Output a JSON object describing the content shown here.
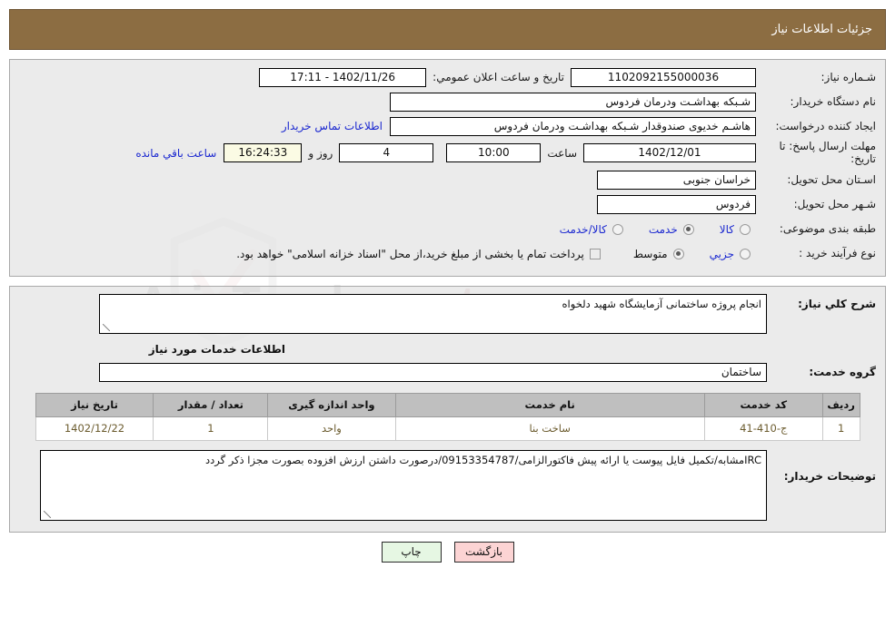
{
  "header": {
    "title": "جزئیات اطلاعات نیاز"
  },
  "form": {
    "need_number_label": "شـماره نیاز:",
    "need_number_value": "1102092155000036",
    "announce_label": "تاریخ و ساعت اعلان عمومي:",
    "announce_value": "1402/11/26 - 17:11",
    "buyer_org_label": "نام دستگاه خریدار:",
    "buyer_org_value": "شـبکه بهداشـت ودرمان فردوس",
    "creator_label": "ایجاد کننده درخواست:",
    "creator_value": "هاشـم خدیوی صندوقدار شـبکه بهداشـت ودرمان فردوس",
    "contact_link": "اطلاعات تماس خریدار",
    "deadline_label": "مهلت ارسال پاسخ: تا تاریخ:",
    "deadline_date": "1402/12/01",
    "hour_label": "ساعت",
    "deadline_time": "10:00",
    "days_value": "4",
    "days_label": "روز و",
    "countdown_value": "16:24:33",
    "remaining_label": "ساعت باقي مانده",
    "province_label": "اسـتان محل تحویل:",
    "province_value": "خراسان جنوبی",
    "city_label": "شـهر محل تحویل:",
    "city_value": "فردوس",
    "category_label": "طبقه بندی موضوعی:",
    "category_options": [
      {
        "label": "کالا",
        "selected": false
      },
      {
        "label": "خدمت",
        "selected": true
      },
      {
        "label": "کالا/خدمت",
        "selected": false
      }
    ],
    "process_label": "نوع فرآیند خرید :",
    "process_options": [
      {
        "label": "جزیي",
        "selected": false
      },
      {
        "label": "متوسط",
        "selected": true
      }
    ],
    "treasury_checkbox_checked": false,
    "treasury_text": "پرداخت تمام یا بخشی از مبلغ خرید،از محل \"اسناد خزانه اسلامی\" خواهد بود."
  },
  "description": {
    "general_label": "شرح کلي نیاز:",
    "general_value": "انجام پروژه ساختمانی آزمایشگاه شهید دلخواه",
    "services_info_title": "اطلاعات خدمات مورد نیاز",
    "service_group_label": "گروه خدمت:",
    "service_group_value": "ساختمان"
  },
  "table": {
    "columns": [
      "ردیف",
      "کد خدمت",
      "نام خدمت",
      "واحد اندازه گیری",
      "تعداد / مقدار",
      "تاریخ نیاز"
    ],
    "rows": [
      {
        "radif": "1",
        "code": "ج-410-41",
        "name": "ساخت بنا",
        "unit": "واحد",
        "qty": "1",
        "need_date": "1402/12/22"
      }
    ]
  },
  "notes": {
    "label": "توضیحات خریدار:",
    "value": "IRCمشابه/تکمیل فایل پیوست یا ارائه پیش فاکتورالزامی/09153354787/درصورت داشتن ارزش افزوده بصورت مجزا ذکر گردد"
  },
  "footer": {
    "back_label": "بازگشت",
    "print_label": "چاپ"
  },
  "watermark": {
    "text": "AriaTender",
    "suffix": ".net"
  },
  "colors": {
    "header_bg": "#8c6d42",
    "panel_bg": "#e3e3e3",
    "link": "#1b28d0",
    "table_header_bg": "#bfbfbf",
    "table_cell_text": "#6b5b2e",
    "back_btn_bg": "#fcd4d4",
    "print_btn_bg": "#e6f7e3",
    "countdown_bg": "#fbfbe4"
  }
}
